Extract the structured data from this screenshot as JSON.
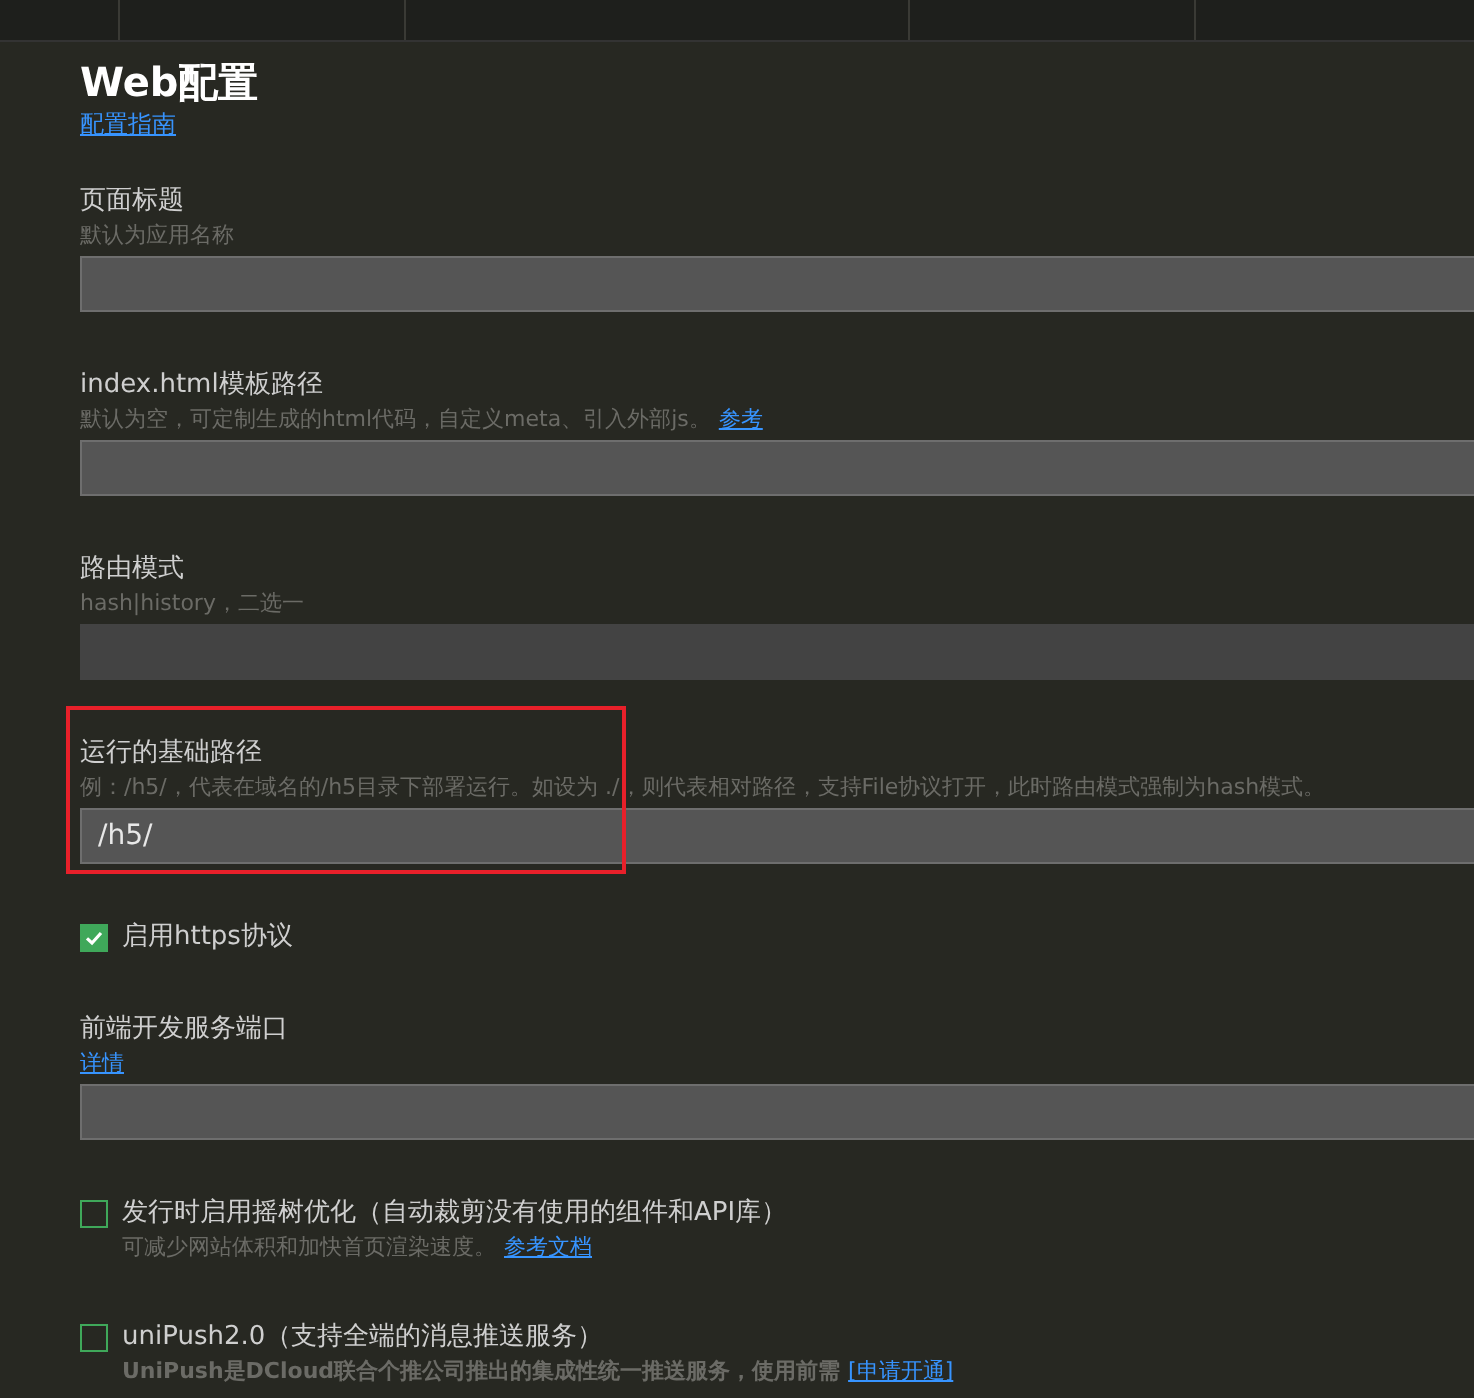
{
  "title": "Web配置",
  "guide_link": "配置指南",
  "items": [
    {
      "kind": "field",
      "label": "页面标题",
      "hint": "默认为应用名称",
      "disabled": false
    },
    {
      "kind": "field",
      "label": "index.html模板路径",
      "hint": "默认为空，可定制生成的html代码，自定义meta、引入外部js。",
      "hint_link": "参考",
      "disabled": false
    },
    {
      "kind": "field",
      "label": "路由模式",
      "hint": "hash|history，二选一",
      "disabled": true
    },
    {
      "kind": "field",
      "label": "运行的基础路径",
      "hint": "例：/h5/，代表在域名的/h5目录下部署运行。如设为 ./，则代表相对路径，支持File协议打开，此时路由模式强制为hash模式。",
      "value": "/h5/",
      "disabled": false,
      "highlighted": true
    },
    {
      "kind": "checkbox",
      "label": "启用https协议",
      "checked": true
    },
    {
      "kind": "field",
      "label": "前端开发服务端口",
      "hint_link": "详情",
      "disabled": false
    },
    {
      "kind": "checkbox",
      "label": "发行时启用摇树优化（自动裁剪没有使用的组件和API库）",
      "hint": "可减少网站体积和加快首页渲染速度。",
      "hint_link": "参考文档",
      "checked": false
    },
    {
      "kind": "checkbox",
      "label": "uniPush2.0（支持全端的消息推送服务）",
      "hint": "UniPush是DCloud联合个推公司推出的集成性统一推送服务，使用前需",
      "hint_bold": true,
      "hint_link": "[申请开通]",
      "checked": false
    }
  ]
}
